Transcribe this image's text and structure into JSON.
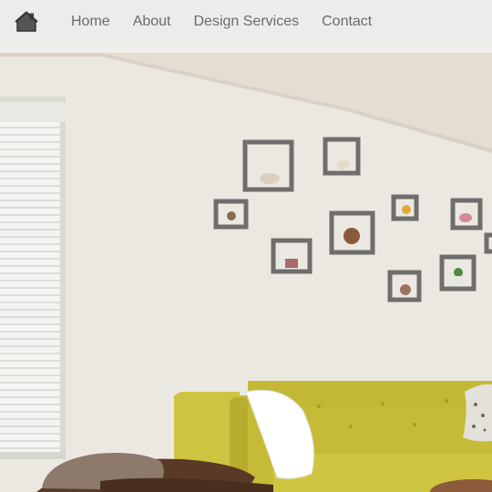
{
  "nav": {
    "home_icon": "home-icon",
    "links": [
      {
        "label": "Home"
      },
      {
        "label": "About"
      },
      {
        "label": "Design Services"
      },
      {
        "label": "Contact"
      }
    ]
  },
  "hero": {
    "description": "",
    "colors": {
      "nav_bg": "#ececec",
      "nav_text": "#6b6b6b",
      "wall": "#ebe8e2",
      "sofa": "#c9bd3c",
      "shelf": "#6f6e6c"
    }
  }
}
